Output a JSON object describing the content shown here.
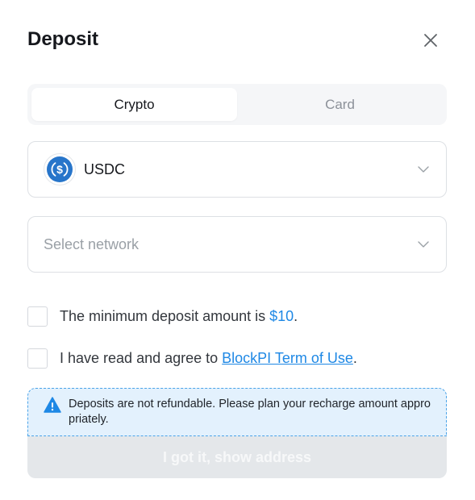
{
  "dialog": {
    "title": "Deposit",
    "close_icon": "close-icon"
  },
  "tabs": [
    {
      "label": "Crypto",
      "active": true
    },
    {
      "label": "Card",
      "active": false
    }
  ],
  "token_select": {
    "value": "USDC",
    "icon": "usdc-coin-icon",
    "chevron_icon": "chevron-down-icon"
  },
  "network_select": {
    "placeholder": "Select network",
    "chevron_icon": "chevron-down-icon"
  },
  "checks": {
    "minimum": {
      "prefix": "The minimum deposit amount is ",
      "amount": "$10",
      "suffix": ".",
      "checked": false
    },
    "terms": {
      "prefix": "I have read and agree to ",
      "link": "BlockPI Term of Use",
      "suffix": ".",
      "checked": false
    }
  },
  "notice": {
    "icon": "warning-icon",
    "text": "Deposits are not refundable. Please plan your recharge amount appropriately."
  },
  "cta": {
    "label": "I got it, show address",
    "enabled": false
  },
  "colors": {
    "accent": "#1e88e5",
    "notice_bg": "#e3f1fd",
    "disabled_button": "#e4e7ea"
  }
}
